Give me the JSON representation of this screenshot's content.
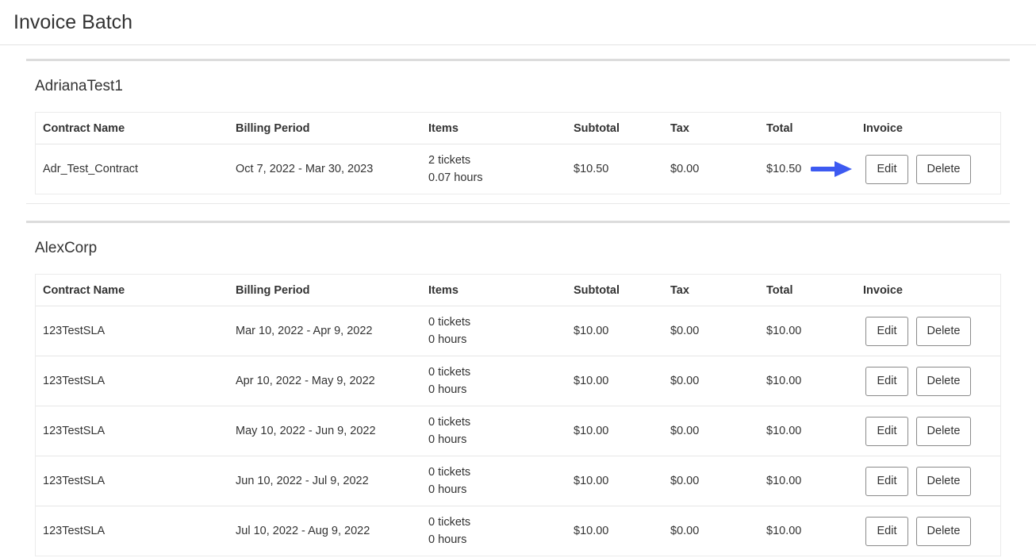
{
  "page": {
    "title": "Invoice Batch"
  },
  "columns": [
    "Contract Name",
    "Billing Period",
    "Items",
    "Subtotal",
    "Tax",
    "Total",
    "Invoice"
  ],
  "groups": [
    {
      "name": "AdrianaTest1",
      "rows": [
        {
          "contract": "Adr_Test_Contract",
          "period": "Oct 7, 2022 - Mar 30, 2023",
          "tickets": "2 tickets",
          "hours": "0.07 hours",
          "subtotal": "$10.50",
          "tax": "$0.00",
          "total": "$10.50",
          "edit_label": "Edit",
          "delete_label": "Delete"
        }
      ]
    },
    {
      "name": "AlexCorp",
      "rows": [
        {
          "contract": "123TestSLA",
          "period": "Mar 10, 2022 - Apr 9, 2022",
          "tickets": "0 tickets",
          "hours": "0 hours",
          "subtotal": "$10.00",
          "tax": "$0.00",
          "total": "$10.00",
          "edit_label": "Edit",
          "delete_label": "Delete"
        },
        {
          "contract": "123TestSLA",
          "period": "Apr 10, 2022 - May 9, 2022",
          "tickets": "0 tickets",
          "hours": "0 hours",
          "subtotal": "$10.00",
          "tax": "$0.00",
          "total": "$10.00",
          "edit_label": "Edit",
          "delete_label": "Delete"
        },
        {
          "contract": "123TestSLA",
          "period": "May 10, 2022 - Jun 9, 2022",
          "tickets": "0 tickets",
          "hours": "0 hours",
          "subtotal": "$10.00",
          "tax": "$0.00",
          "total": "$10.00",
          "edit_label": "Edit",
          "delete_label": "Delete"
        },
        {
          "contract": "123TestSLA",
          "period": "Jun 10, 2022 - Jul 9, 2022",
          "tickets": "0 tickets",
          "hours": "0 hours",
          "subtotal": "$10.00",
          "tax": "$0.00",
          "total": "$10.00",
          "edit_label": "Edit",
          "delete_label": "Delete"
        },
        {
          "contract": "123TestSLA",
          "period": "Jul 10, 2022 - Aug 9, 2022",
          "tickets": "0 tickets",
          "hours": "0 hours",
          "subtotal": "$10.00",
          "tax": "$0.00",
          "total": "$10.00",
          "edit_label": "Edit",
          "delete_label": "Delete"
        }
      ]
    }
  ],
  "annotation": {
    "icon": "arrow-right-icon",
    "color": "#3d5af1"
  }
}
